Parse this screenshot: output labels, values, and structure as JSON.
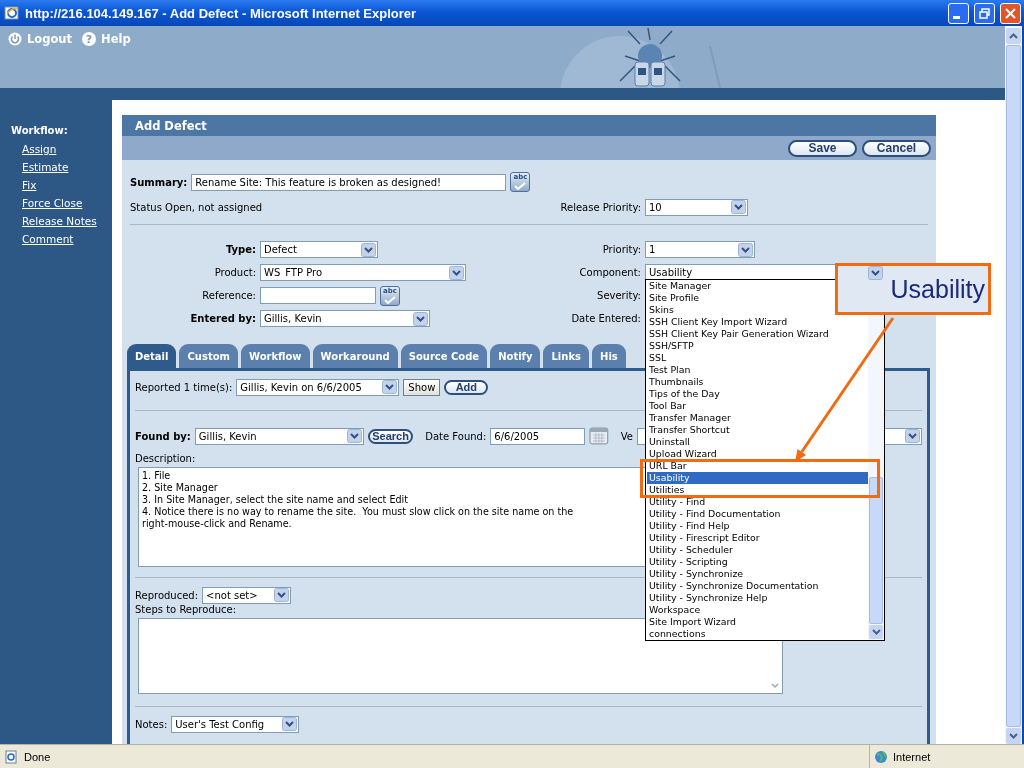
{
  "window": {
    "title": "http://216.104.149.167 - Add Defect - Microsoft Internet Explorer"
  },
  "header": {
    "links": [
      {
        "label": "Logout"
      },
      {
        "label": "Help",
        "glyph": "?"
      }
    ]
  },
  "sidebar": {
    "heading": "Workflow:",
    "items": [
      "Assign",
      "Estimate",
      "Fix",
      "Force Close",
      "Release Notes",
      "Comment"
    ]
  },
  "form": {
    "title": "Add Defect",
    "buttons": [
      "Save",
      "Cancel"
    ],
    "summary": {
      "label": "Summary:",
      "value": "Rename Site: This feature is broken as designed!",
      "spellcheck": "abc"
    },
    "status": "Status Open, not assigned",
    "release_priority": {
      "label": "Release Priority:",
      "value": "10"
    },
    "fields_left": [
      {
        "label": "Type:",
        "value": "Defect",
        "kind": "select",
        "bold": true
      },
      {
        "label": "Product:",
        "value": "WS_FTP Pro",
        "kind": "select",
        "bold": false
      },
      {
        "label": "Reference:",
        "kind": "text",
        "bold": false,
        "spellcheck": "abc"
      },
      {
        "label": "Entered by:",
        "value": "Gillis, Kevin",
        "kind": "select",
        "bold": true
      }
    ],
    "fields_right": [
      {
        "label": "Priority:",
        "value": "1",
        "kind": "select"
      },
      {
        "label": "Component:",
        "value": "Usability",
        "kind": "select"
      },
      {
        "label": "Severity:",
        "kind": "label"
      },
      {
        "label": "Date Entered:",
        "kind": "label"
      }
    ]
  },
  "tabs": [
    {
      "label": "Detail",
      "selected": true
    },
    {
      "label": "Custom",
      "selected": false
    },
    {
      "label": "Workflow",
      "selected": false
    },
    {
      "label": "Workaround",
      "selected": false
    },
    {
      "label": "Source Code",
      "selected": false
    },
    {
      "label": "Notify",
      "selected": false
    },
    {
      "label": "Links",
      "selected": false
    },
    {
      "label": "His",
      "selected": false
    }
  ],
  "detail": {
    "reported": {
      "label": "Reported 1 time(s):",
      "value": "Gillis, Kevin on 6/6/2005",
      "show_button": "Show",
      "add_button": "Add"
    },
    "found_by": {
      "label": "Found by:",
      "value": "Gillis, Kevin",
      "button": "Search"
    },
    "date_found": {
      "label": "Date Found:",
      "value": "6/6/2005"
    },
    "version": {
      "label": "Ve"
    },
    "description": {
      "label": "Description:",
      "lines": [
        "1. File",
        "2. Site Manager",
        "3. In Site Manager, select the site name and select Edit",
        "4. Notice there is no way to rename the site.  You must slow click on the site name on the",
        "right-mouse-click and Rename."
      ]
    },
    "reproduced": {
      "label": "Reproduced:",
      "value": "<not set>"
    },
    "steps": {
      "label": "Steps to Reproduce:"
    },
    "notes": {
      "label": "Notes:",
      "value": "User's Test Config"
    }
  },
  "dropdown": {
    "items": [
      {
        "label": "Site Manager",
        "selected": false
      },
      {
        "label": "Site Profile",
        "selected": false
      },
      {
        "label": "Skins",
        "selected": false
      },
      {
        "label": "SSH Client Key Import Wizard",
        "selected": false
      },
      {
        "label": "SSH Client Key Pair Generation Wizard",
        "selected": false
      },
      {
        "label": "SSH/SFTP",
        "selected": false
      },
      {
        "label": "SSL",
        "selected": false
      },
      {
        "label": "Test Plan",
        "selected": false
      },
      {
        "label": "Thumbnails",
        "selected": false
      },
      {
        "label": "Tips of the Day",
        "selected": false
      },
      {
        "label": "Tool Bar",
        "selected": false
      },
      {
        "label": "Transfer Manager",
        "selected": false
      },
      {
        "label": "Transfer Shortcut",
        "selected": false
      },
      {
        "label": "Uninstall",
        "selected": false
      },
      {
        "label": "Upload Wizard",
        "selected": false
      },
      {
        "label": "URL Bar",
        "selected": false
      },
      {
        "label": "Usability",
        "selected": true
      },
      {
        "label": "Utilities",
        "selected": false
      },
      {
        "label": "Utility - Find",
        "selected": false
      },
      {
        "label": "Utility - Find Documentation",
        "selected": false
      },
      {
        "label": "Utility - Find Help",
        "selected": false
      },
      {
        "label": "Utility - Firescript Editor",
        "selected": false
      },
      {
        "label": "Utility - Scheduler",
        "selected": false
      },
      {
        "label": "Utility - Scripting",
        "selected": false
      },
      {
        "label": "Utility - Synchronize",
        "selected": false
      },
      {
        "label": "Utility - Synchronize Documentation",
        "selected": false
      },
      {
        "label": "Utility - Synchronize Help",
        "selected": false
      },
      {
        "label": "Workspace",
        "selected": false
      },
      {
        "label": "Site Import Wizard",
        "selected": false
      },
      {
        "label": "connections",
        "selected": false
      }
    ]
  },
  "callout": {
    "text": "Usability"
  },
  "status_bar": {
    "text": "Done",
    "zone": "Internet"
  }
}
